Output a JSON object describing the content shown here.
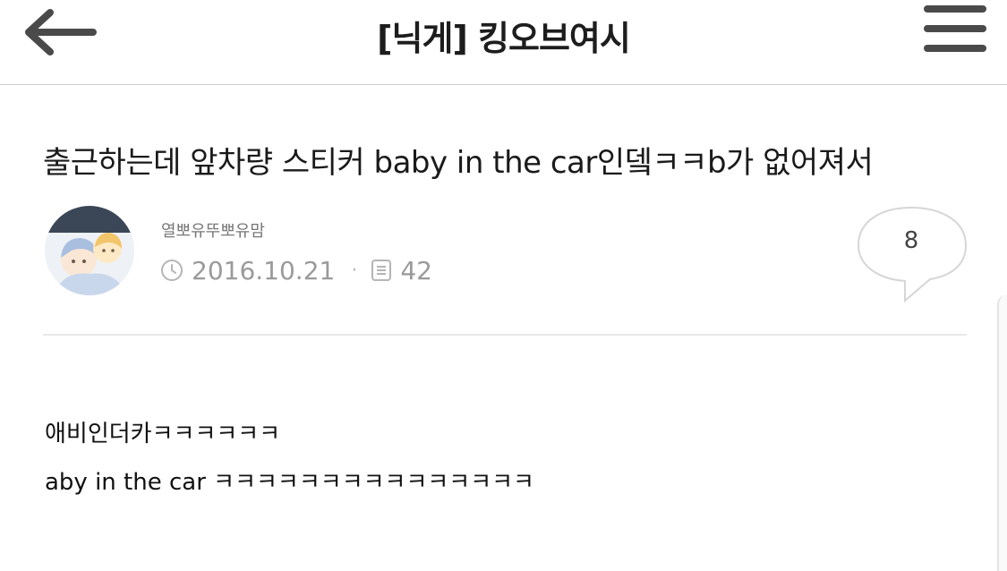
{
  "header": {
    "back_icon": "arrow-left-icon",
    "board_title": "[닉게] 킹오브여시",
    "menu_icon": "hamburger-menu-icon"
  },
  "post": {
    "title": "출근하는데 앞차량 스티커 baby in the car인뎈ㅋㅋb가 없어져서",
    "author": "열뽀유뚜뽀유맘",
    "date": "2016.10.21",
    "views": "42",
    "comment_count": "8",
    "body_lines": [
      "애비인더카ㅋㅋㅋㅋㅋㅋ",
      "aby in the car ㅋㅋㅋㅋㅋㅋㅋㅋㅋㅋㅋㅋㅋㅋㅋ"
    ]
  },
  "icons": {
    "clock": "clock-icon",
    "views": "document-icon",
    "comment": "speech-bubble-icon"
  },
  "colors": {
    "text": "#1a1a1a",
    "meta": "#9a9a9a",
    "divider": "#cfcfcf"
  }
}
